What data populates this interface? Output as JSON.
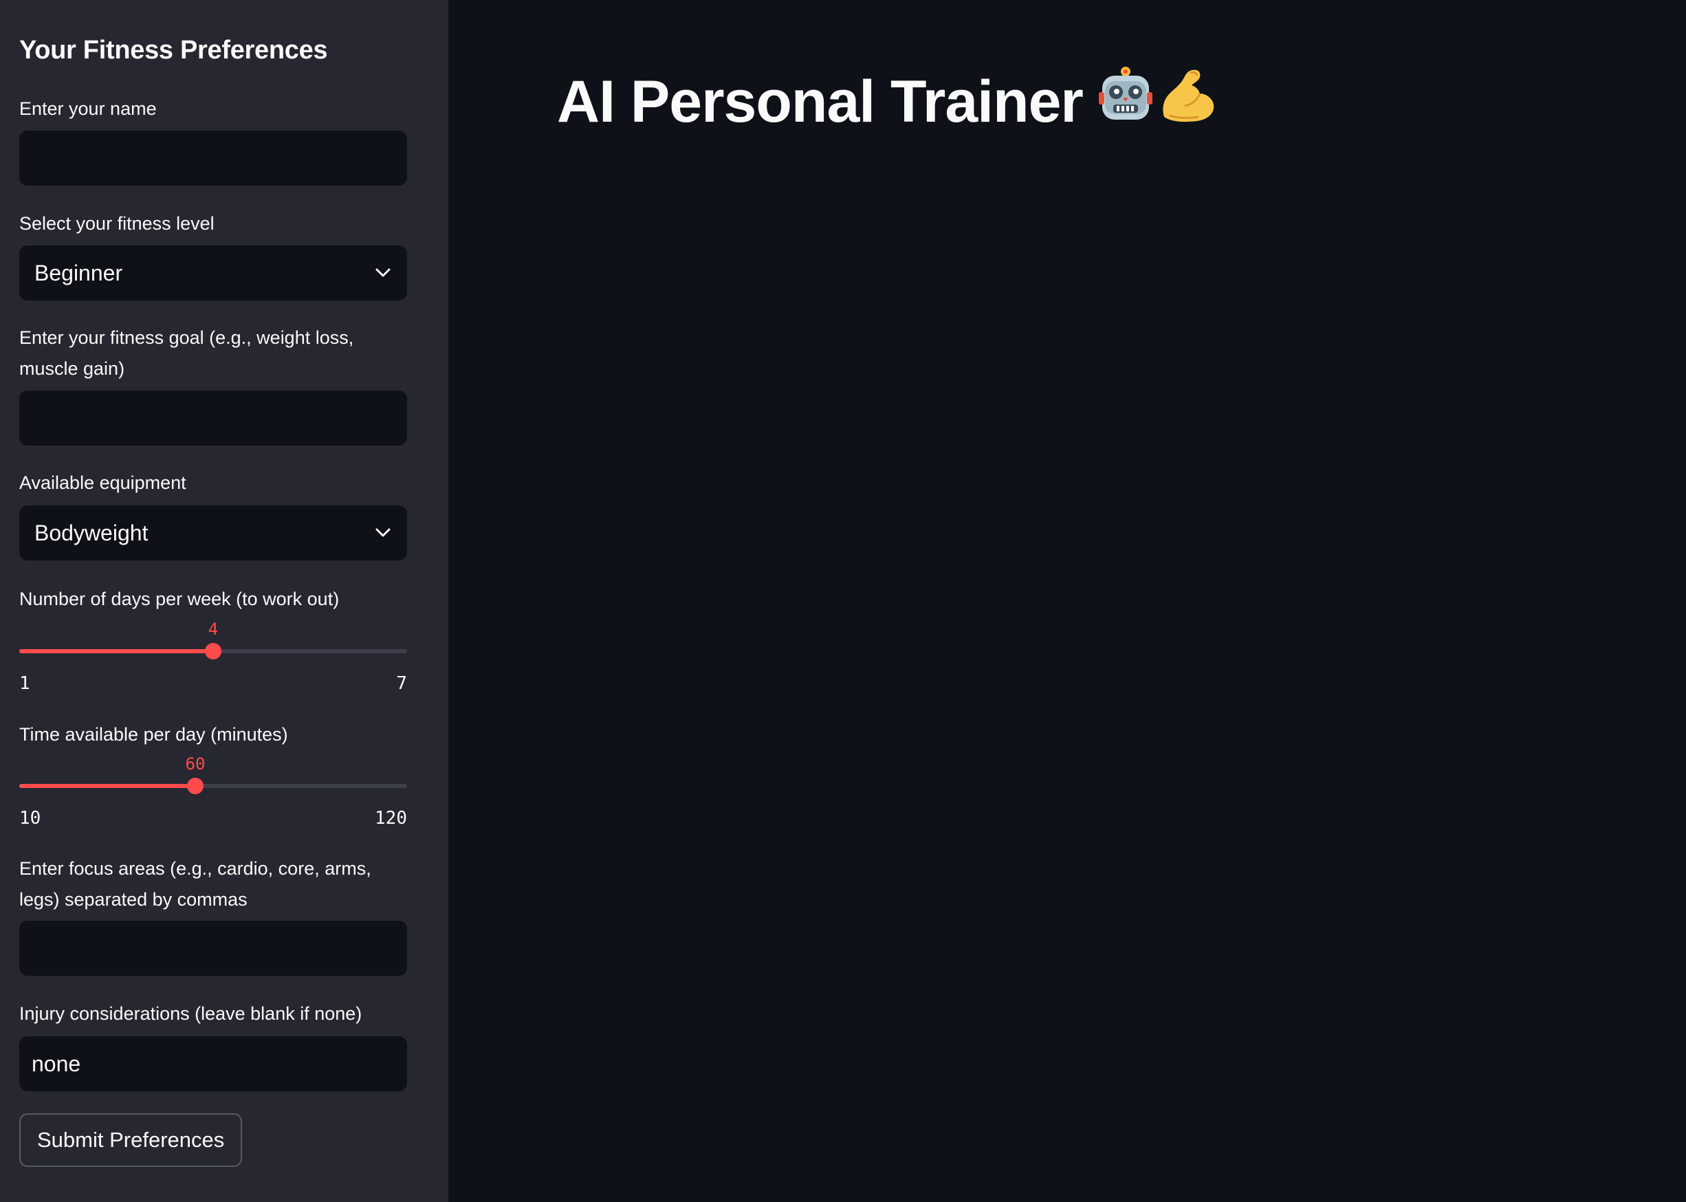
{
  "sidebar": {
    "title": "Your Fitness Preferences",
    "name_field": {
      "label": "Enter your name",
      "value": ""
    },
    "fitness_level": {
      "label": "Select your fitness level",
      "value": "Beginner"
    },
    "goal_field": {
      "label": "Enter your fitness goal (e.g., weight loss, muscle gain)",
      "value": ""
    },
    "equipment": {
      "label": "Available equipment",
      "value": "Bodyweight"
    },
    "days_slider": {
      "label": "Number of days per week (to work out)",
      "value": "4",
      "min": "1",
      "max": "7",
      "fraction": 0.5
    },
    "time_slider": {
      "label": "Time available per day (minutes)",
      "value": "60",
      "min": "10",
      "max": "120",
      "fraction": 0.4545
    },
    "focus_field": {
      "label": "Enter focus areas (e.g., cardio, core, arms, legs) separated by commas",
      "value": ""
    },
    "injury_field": {
      "label": "Injury considerations (leave blank if none)",
      "value": "none"
    },
    "submit_label": "Submit Preferences"
  },
  "main": {
    "title": "AI Personal Trainer",
    "title_icons": [
      "robot-icon",
      "flexed-biceps-icon"
    ]
  },
  "colors": {
    "accent": "#ff4b4b",
    "background": "#0e1117",
    "sidebar_background": "#262730"
  }
}
